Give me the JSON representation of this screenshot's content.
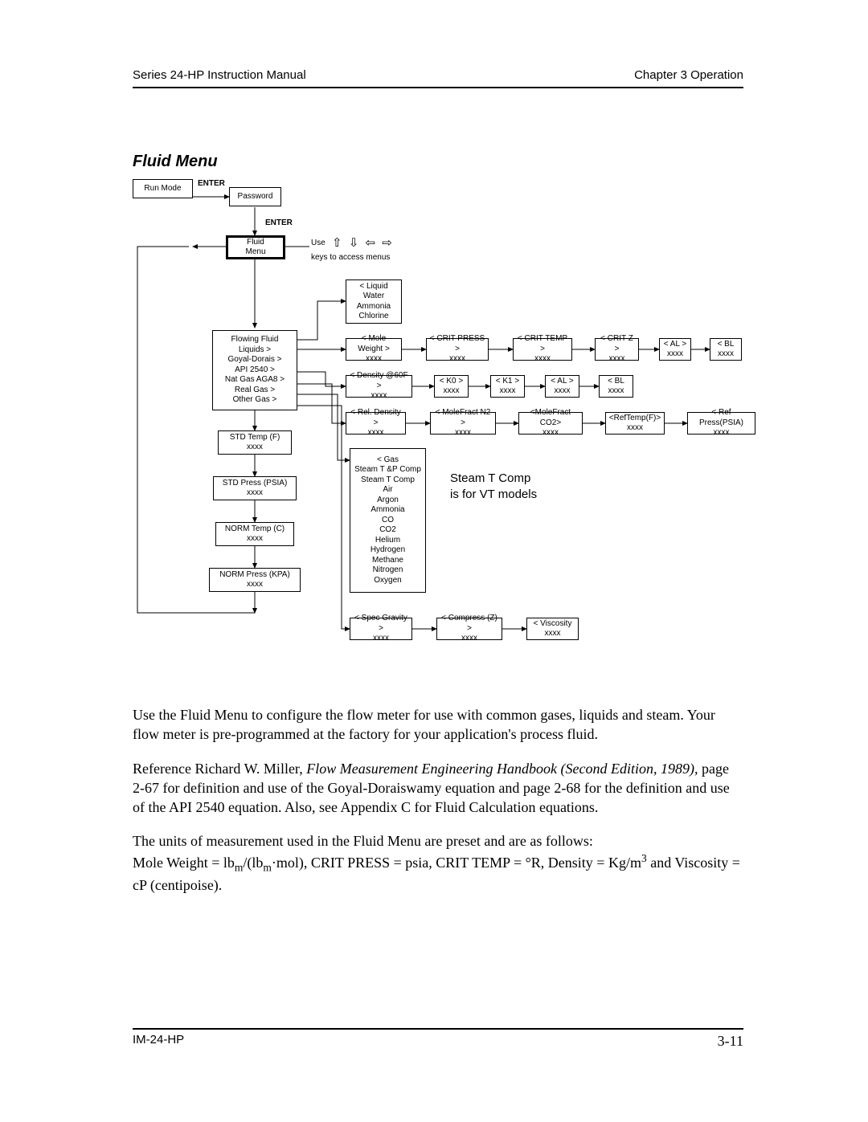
{
  "header": {
    "left": "Series 24-HP Instruction Manual",
    "right": "Chapter 3 Operation"
  },
  "title": "Fluid Menu",
  "diagram": {
    "run_mode": "Run Mode",
    "password": "Password",
    "fluid_menu": "Fluid\nMenu",
    "enter1": "ENTER",
    "enter2": "ENTER",
    "use": "Use",
    "use_keys": "keys to access menus",
    "arrows_glyph": "⇧ ⇩ ⇦ ⇨",
    "liquid_list": "< Liquid\nWater\nAmmonia\nChlorine",
    "flowing_fluid": "Flowing Fluid\nLiquids >\nGoyal-Dorais >\nAPI 2540 >\nNat Gas AGA8 >\nReal Gas >\nOther Gas >",
    "mole_weight": "< Mole Weight >\nxxxx",
    "crit_press": "< CRIT PRESS >\nxxxx",
    "crit_temp": "< CRIT TEMP >\nxxxx",
    "crit_z": "< CRIT Z >\nxxxx",
    "al": "< AL >\nxxxx",
    "bl": "< BL\nxxxx",
    "density60": "< Density  @60F >\nxxxx",
    "k0": "< K0 >\nxxxx",
    "k1": "< K1 >\nxxxx",
    "al2": "< AL >\nxxxx",
    "bl2": "< BL\nxxxx",
    "rel_density": "< Rel. Density >\nxxxx",
    "molefract_n2": "< MoleFract N2 >\nxxxx",
    "molefract_co2": "<MoleFract CO2>\nxxxx",
    "reftempf": "<RefTemp(F)>\nxxxx",
    "refpresspsia": "< Ref Press(PSIA)\nxxxx",
    "std_temp": "STD Temp (F)\nxxxx",
    "std_press": "STD Press (PSIA)\nxxxx",
    "norm_temp": "NORM Temp (C)\nxxxx",
    "norm_press": "NORM Press  (KPA)\nxxxx",
    "gas_list": "< Gas\nSteam T &P Comp\nSteam T Comp\nAir\nArgon\nAmmonia\nCO\nCO2\nHelium\nHydrogen\nMethane\nNitrogen\nOxygen",
    "steam_note": "Steam T Comp\nis for VT models",
    "spec_gravity": "< Spec Gravity >\nxxxx",
    "compress_z": "< Compress (Z) >\nxxxx",
    "viscosity": "< Viscosity\nxxxx"
  },
  "paragraphs": {
    "p1": "Use the Fluid Menu to configure the flow meter for use with common gases, liquids and steam. Your flow meter is pre-programmed at the factory for your application's process fluid.",
    "p2_a": "Reference Richard W. Miller, ",
    "p2_i": "Flow Measurement Engineering Handbook (Second Edition, 1989),",
    "p2_b": " page 2-67 for definition and use of the Goyal-Doraiswamy equation and page 2-68 for the definition and use of the API 2540 equation. Also, see Appendix C for Fluid Calculation equations.",
    "p3_a": "The units of measurement used in the Fluid Menu are preset and are as follows:",
    "p3_b1": "Mole Weight = lb",
    "p3_sub1": "m",
    "p3_b2": "/(lb",
    "p3_sub2": "m",
    "p3_b3": "·mol), CRIT PRESS = psia, CRIT TEMP = °R, Density = Kg/m",
    "p3_sup": "3",
    "p3_b4": " and Viscosity = cP (centipoise)."
  },
  "footer": {
    "left": "IM-24-HP",
    "right": "3-11"
  }
}
